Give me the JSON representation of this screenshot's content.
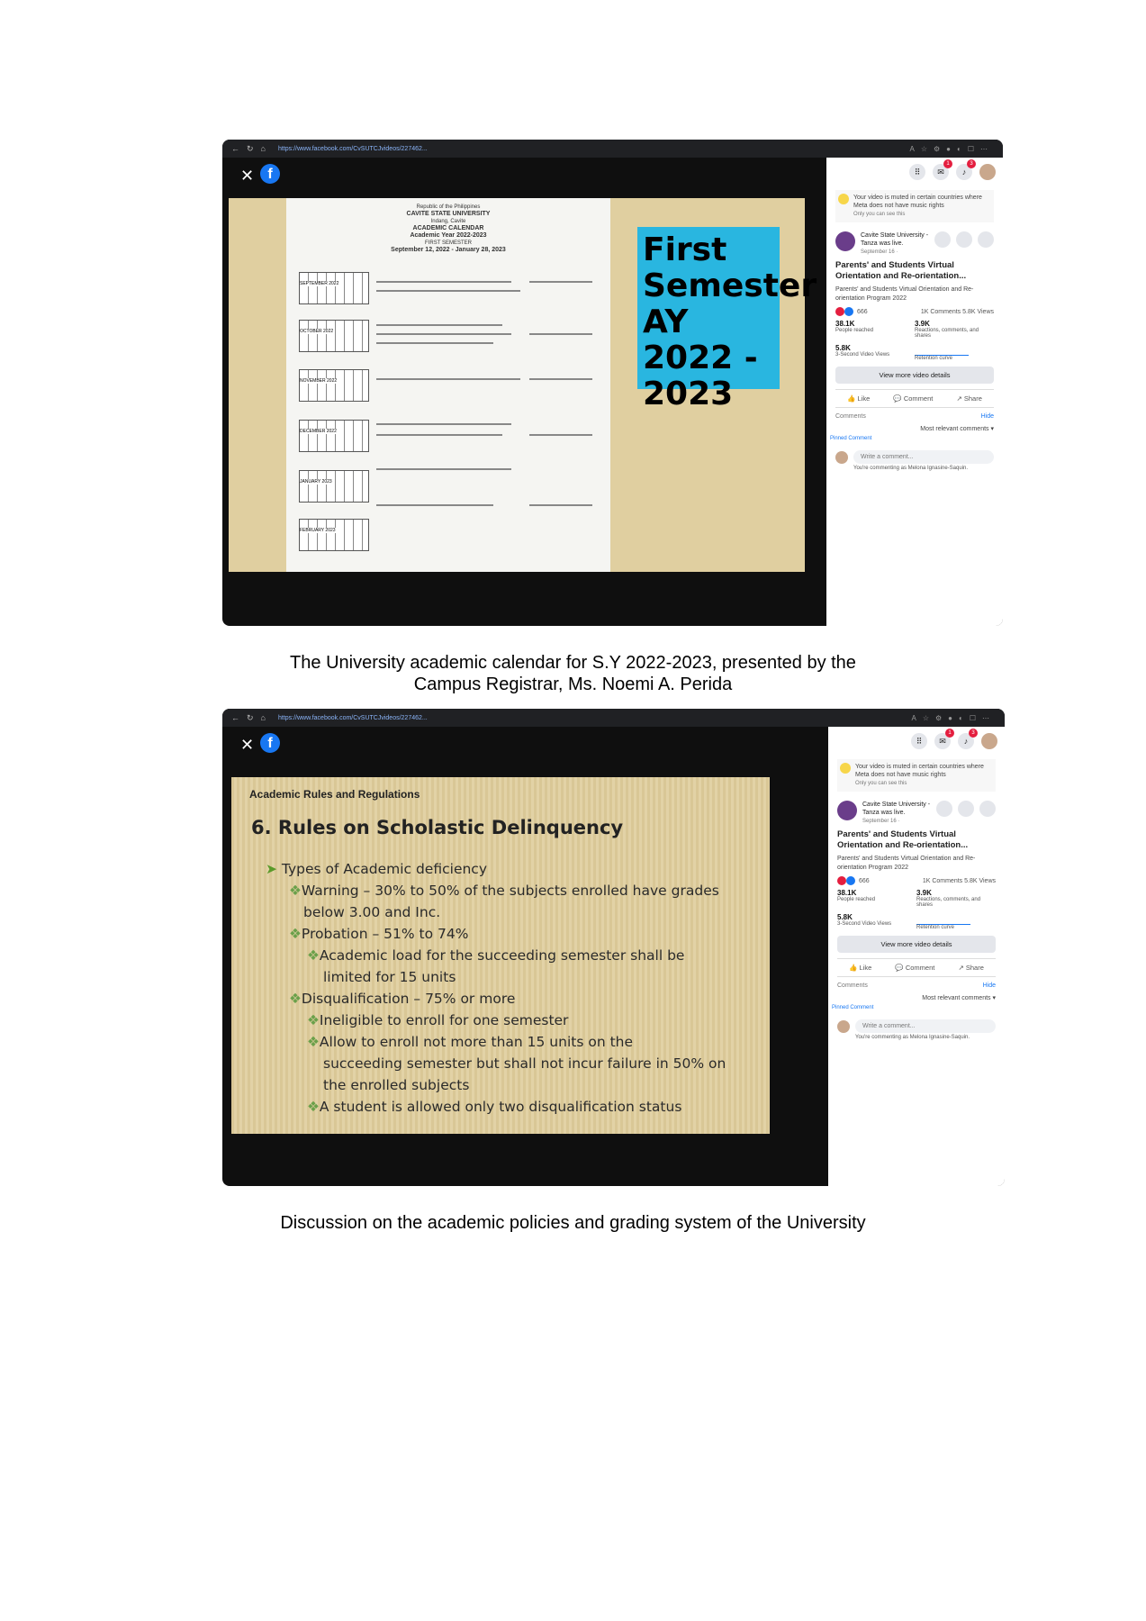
{
  "screenshot1": {
    "browser_url": "https://www.facebook.com/CvSUTCJvideos/227462...",
    "calendar": {
      "header_lines": [
        "Republic of the Philippines",
        "CAVITE STATE UNIVERSITY",
        "Indang, Cavite",
        "ACADEMIC CALENDAR",
        "Academic Year 2022-2023",
        "FIRST SEMESTER"
      ],
      "date_range": "September 12, 2022 - January 28, 2023",
      "month_labels": [
        "SEPTEMBER 2022",
        "OCTOBER 2022",
        "NOVEMBER 2022",
        "DECEMBER 2022",
        "JANUARY 2023",
        "FEBRUARY 2023"
      ]
    },
    "slide_title_lines": [
      "First",
      "Semester",
      "AY 2022 -",
      "2023"
    ]
  },
  "caption1_lines": [
    "The University academic calendar for S.Y 2022-2023, presented by the",
    "Campus Registrar, Ms. Noemi A. Perida"
  ],
  "panel": {
    "notif_count": "3",
    "messenger_count": "1",
    "muted_notice": "Your video is muted in certain countries where Meta does not have music rights",
    "only_you": "Only you can see this",
    "page_name": "Cavite State University - Tanza",
    "was_live": "was live.",
    "date": "September 16 · ",
    "post_title": "Parents' and Students Virtual Orientation and Re-orientation...",
    "post_desc": "Parents' and Students Virtual Orientation and Re-orientation Program 2022",
    "reactions": "666",
    "comments_views": "1K Comments  5.8K Views",
    "people_reached_value": "38.1K",
    "people_reached_label": "People reached",
    "engagement_value": "3.9K",
    "engagement_label": "Reactions, comments, and shares",
    "views3s_value": "5.8K",
    "views3s_label": "3-Second Video Views",
    "retention_label": "Retention curve",
    "view_more": "View more video details",
    "like": "Like",
    "comment": "Comment",
    "share": "Share",
    "comments_label": "Comments",
    "hide": "Hide",
    "most_relevant": "Most relevant comments ▾",
    "pinned": "Pinned Comment",
    "write_comment": "Write a comment...",
    "commenting_as": "You're commenting as Melona Ignasine-Saquin."
  },
  "screenshot2": {
    "browser_url": "https://www.facebook.com/CvSUTCJvideos/227462...",
    "section_title": "Academic Rules and Regulations",
    "heading": "6.   Rules on Scholastic Delinquency",
    "lines": [
      "Types of Academic deficiency",
      "Warning – 30% to 50% of the subjects enrolled have grades",
      "below 3.00 and Inc.",
      "Probation – 51% to 74%",
      "Academic load for the succeeding semester shall  be",
      "limited for 15 units",
      "Disqualification – 75% or more",
      "Ineligible to enroll for one semester",
      "Allow to enroll not more than 15 units on the",
      "succeeding semester but shall not incur failure in 50% on",
      "the enrolled subjects",
      "A student is allowed only two disqualification status"
    ]
  },
  "caption2": "Discussion on the academic policies and grading system of the University"
}
